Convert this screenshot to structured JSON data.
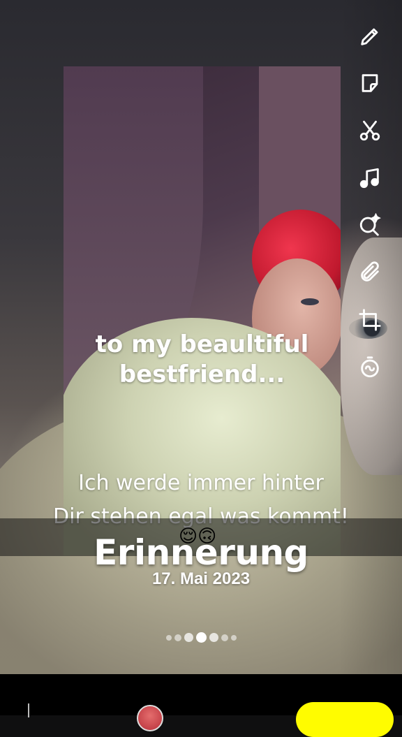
{
  "editor_tools": [
    {
      "icon": "pencil-icon"
    },
    {
      "icon": "sticker-icon"
    },
    {
      "icon": "scissors-icon"
    },
    {
      "icon": "music-note-icon"
    },
    {
      "icon": "lens-search-icon"
    },
    {
      "icon": "paperclip-icon"
    },
    {
      "icon": "crop-icon"
    },
    {
      "icon": "timer-icon"
    }
  ],
  "captions": {
    "overlay_line1": "to my beaultiful",
    "overlay_line2": "bestfriend...",
    "message_line1": "Ich werde immer hinter",
    "message_line2": "Dir stehen egal was kommt!",
    "emojis": "😌🙃"
  },
  "memory": {
    "title": "Erinnerung",
    "date": "17. Mai 2023"
  },
  "pagination": {
    "total": 7,
    "active_index": 3
  },
  "colors": {
    "send_button": "#fffc00",
    "avatar": "#d84a4f"
  }
}
